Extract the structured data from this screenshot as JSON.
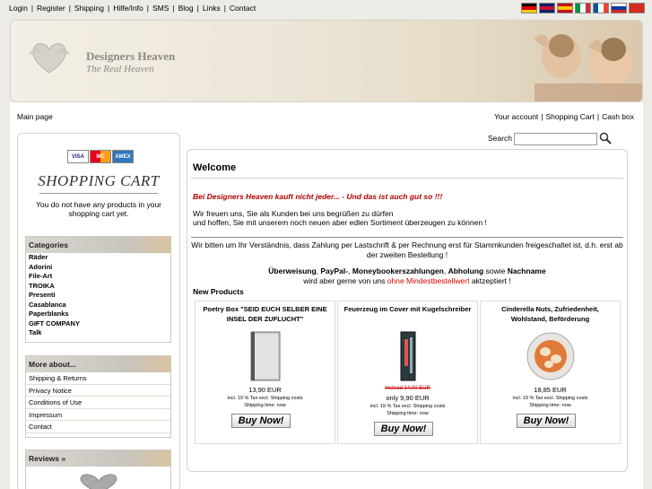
{
  "top_links": [
    "Login",
    "Register",
    "Shipping",
    "Hilfe/Info",
    "SMS",
    "Blog",
    "Links",
    "Contact"
  ],
  "flags": [
    {
      "name": "german-flag-icon",
      "colors": [
        "#000000",
        "#dd0000",
        "#ffce00"
      ],
      "dir": "h"
    },
    {
      "name": "english-flag-icon",
      "colors": [
        "#012169",
        "#c8102e",
        "#012169"
      ],
      "dir": "h"
    },
    {
      "name": "spanish-flag-icon",
      "colors": [
        "#c60b1e",
        "#ffc400",
        "#c60b1e"
      ],
      "dir": "h"
    },
    {
      "name": "italian-flag-icon",
      "colors": [
        "#009246",
        "#ffffff",
        "#ce2b37"
      ],
      "dir": "v"
    },
    {
      "name": "french-flag-icon",
      "colors": [
        "#0055a4",
        "#ffffff",
        "#ef4135"
      ],
      "dir": "v"
    },
    {
      "name": "russian-flag-icon",
      "colors": [
        "#ffffff",
        "#0039a6",
        "#d52b1e"
      ],
      "dir": "h"
    },
    {
      "name": "swiss-flag-icon",
      "colors": [
        "#d52b1e",
        "#d52b1e",
        "#d52b1e"
      ],
      "dir": "h"
    }
  ],
  "logo": {
    "title": "Designers Heaven",
    "subtitle": "The Real Heaven"
  },
  "nav": {
    "main_page": "Main page",
    "right": [
      "Your account",
      "Shopping Cart",
      "Cash box"
    ]
  },
  "cart": {
    "cards": [
      "VISA",
      "MC",
      "AMEX"
    ],
    "title": "SHOPPING CART",
    "empty_text": "You do not have any products in your shopping cart yet."
  },
  "categories": {
    "title": "Categories",
    "items": [
      "Räder",
      "Adorini",
      "File-Art",
      "TROIKA",
      "Presenti",
      "Casablanca",
      "Paperblanks",
      "GIFT COMPANY",
      "Talk"
    ]
  },
  "more_about": {
    "title": "More about...",
    "items": [
      "Shipping & Returns",
      "Privacy Notice",
      "Conditions of Use",
      "Impressum",
      "Contact"
    ]
  },
  "reviews": {
    "title": "Reviews »"
  },
  "search": {
    "label": "Search",
    "placeholder": ""
  },
  "welcome": {
    "title": "Welcome",
    "claim": "Bei Designers Heaven kauft nicht jeder... - Und das ist auch gut so !!!",
    "greet_line1": "Wir freuen uns, Sie als Kunden bei uns begrüßen zu dürfen",
    "greet_line2": "und hoffen, Sie mit unserem noch neuen aber edlen Sortiment überzeugen zu können !",
    "notice": "Wir bitten um Ihr Verständnis, dass Zahlung per Lastschrift & per Rechnung erst für Stammkunden freigeschaltet ist, d.h. erst ab der zweiten Bestellung !",
    "pay_methods": [
      "Überweisung",
      "PayPal-",
      "Moneybookerszahlungen",
      "Abholung",
      "Nachname"
    ],
    "pay_join": ", ",
    "pay_sowie": " sowie ",
    "pay_line2_a": "wird aber gerne von uns ",
    "pay_line2_red": "ohne Mindestbestellwert",
    "pay_line2_b": " aktzeptiert !"
  },
  "new_products": {
    "title": "New Products",
    "items": [
      {
        "name": "Poetry Box \"SEID EUCH SELBER EINE INSEL DER ZUFLUCHT\"",
        "old_price": "",
        "price": "13,90 EUR",
        "tax": "incl. 19 % Tax excl. Shipping costs",
        "shipping": "Shipping time: now",
        "buy": "Buy Now!"
      },
      {
        "name": "Feuerzeug im Cover mit Kugelschreiber",
        "old_price": "Instead 14,00 EUR",
        "price": "only 9,90 EUR",
        "tax": "incl. 19 % Tax excl. Shipping costs",
        "shipping": "Shipping time: now",
        "buy": "Buy Now!"
      },
      {
        "name": "Cinderella Nuts, Zufriedenheit, Wohlstand, Beförderung",
        "old_price": "",
        "price": "18,85 EUR",
        "tax": "incl. 19 % Tax excl. Shipping costs",
        "shipping": "Shipping time: now",
        "buy": "Buy Now!"
      }
    ]
  }
}
